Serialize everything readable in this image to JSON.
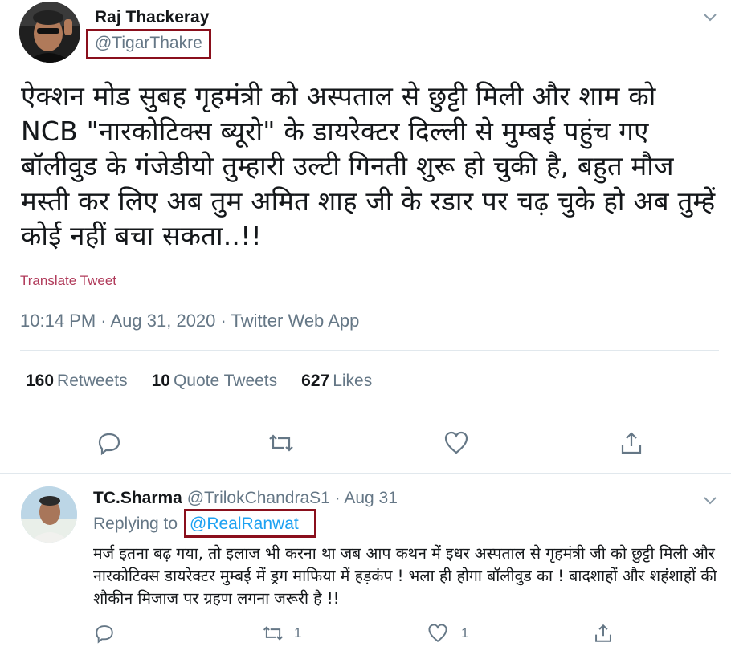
{
  "tweet": {
    "author_name": "Raj Thackeray",
    "handle": "@TigarThakre",
    "text": "ऐक्शन मोड सुबह गृहमंत्री को अस्पताल से छुट्टी मिली और शाम को NCB \"नारकोटिक्स ब्यूरो\" के डायरेक्टर दिल्ली से मुम्बई पहुंच गए बॉलीवुड के गंजेडीयो तुम्हारी उल्टी गिनती शुरू हो चुकी है, बहुत मौज मस्ती कर लिए अब तुम अमित शाह जी के रडार पर चढ़ चुके हो अब तुम्हें कोई नहीं बचा सकता..!!",
    "translate_label": "Translate Tweet",
    "timestamp": "10:14 PM · Aug 31, 2020 · Twitter Web App",
    "stats": {
      "retweets_count": "160",
      "retweets_label": "Retweets",
      "quote_count": "10",
      "quote_label": "Quote Tweets",
      "likes_count": "627",
      "likes_label": "Likes"
    }
  },
  "reply": {
    "author_name": "TC.Sharma",
    "handle_and_date": "@TrilokChandraS1 · Aug 31",
    "replying_to_label": "Replying to",
    "replying_to_handle": "@RealRanwat",
    "text": "मर्ज इतना बढ़ गया, तो इलाज भी करना था जब आप कथन में इधर अस्पताल से गृहमंत्री जी को छुट्टी मिली और नारकोटिक्स डायरेक्टर मुम्बई में ड्रग माफिया में हड़कंप ! भला ही होगा बॉलीवुड का ! बादशाहों और शहंशाहों की शौकीन मिजाज पर ग्रहण लगना जरूरी है !!",
    "retweet_count": "1",
    "like_count": "1"
  },
  "colors": {
    "highlight_box": "#8a0f1c",
    "link_blue": "#1da1f2",
    "secondary_text": "#657786"
  }
}
